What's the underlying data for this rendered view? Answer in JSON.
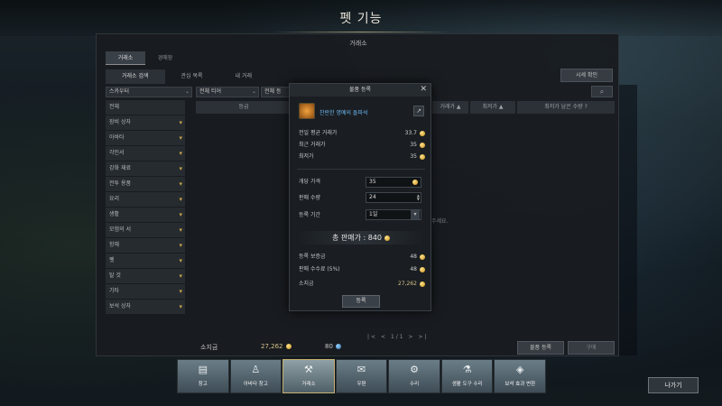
{
  "header": {
    "title": "펫 기능"
  },
  "window": {
    "title": "거래소",
    "tabs": [
      {
        "label": "거래소"
      },
      {
        "label": "경매장"
      }
    ],
    "subtabs": [
      {
        "label": "거래소 검색"
      },
      {
        "label": "관심 목록"
      },
      {
        "label": "내 거래"
      }
    ],
    "market_button": "시세 확인",
    "category_select": "스카우터",
    "filters": [
      {
        "label": "전체 티어"
      },
      {
        "label": "전체 등"
      }
    ],
    "categories": [
      "전체",
      "장비 상자",
      "아바타",
      "각인서",
      "강화 재료",
      "전투 용품",
      "요리",
      "생활",
      "모험의 서",
      "항해",
      "펫",
      "탈 것",
      "기타",
      "보석 상자"
    ],
    "columns": {
      "grade": "등급",
      "price": "거래가",
      "lowest": "최저가",
      "remaining": "최저가 남은 수량"
    },
    "hint_text": "주세요.",
    "footer": {
      "gold_label": "소지금",
      "gold": "27,262",
      "crystal": "80",
      "page": "1/1",
      "register_button": "물품 등록",
      "buy_button": "구매"
    }
  },
  "dialog": {
    "title": "물품 등록",
    "item_name": "찬란한 명예의 돌파석",
    "avg_price_label": "전일 평균 거래가",
    "avg_price": "33.7",
    "recent_price_label": "최근 거래가",
    "recent_price": "35",
    "lowest_price_label": "최저가",
    "lowest_price": "35",
    "unit_price_label": "개당 가격",
    "unit_price": "35",
    "quantity_label": "판매 수량",
    "quantity": "24",
    "period_label": "등록 기간",
    "period": "1일",
    "total_label": "총 판매가 : 840",
    "deposit_label": "등록 보증금",
    "deposit": "48",
    "fee_label": "판매 수수료 (5%)",
    "fee": "48",
    "gold_label": "소지금",
    "gold": "27,262",
    "register_button": "등록"
  },
  "dock": [
    {
      "label": "창고",
      "icon": "storage-icon"
    },
    {
      "label": "아바타 창고",
      "icon": "avatar-storage-icon"
    },
    {
      "label": "거래소",
      "icon": "auction-hammer-icon"
    },
    {
      "label": "우편",
      "icon": "mail-icon"
    },
    {
      "label": "수리",
      "icon": "anvil-icon"
    },
    {
      "label": "생활 도구 수리",
      "icon": "tool-repair-icon"
    },
    {
      "label": "보석 효과 변환",
      "icon": "gem-convert-icon"
    }
  ],
  "exit_button": "나가기",
  "colors": {
    "gold": "#d6c08a",
    "item_name": "#6fb7f0",
    "chevron": "#c9a64a"
  }
}
